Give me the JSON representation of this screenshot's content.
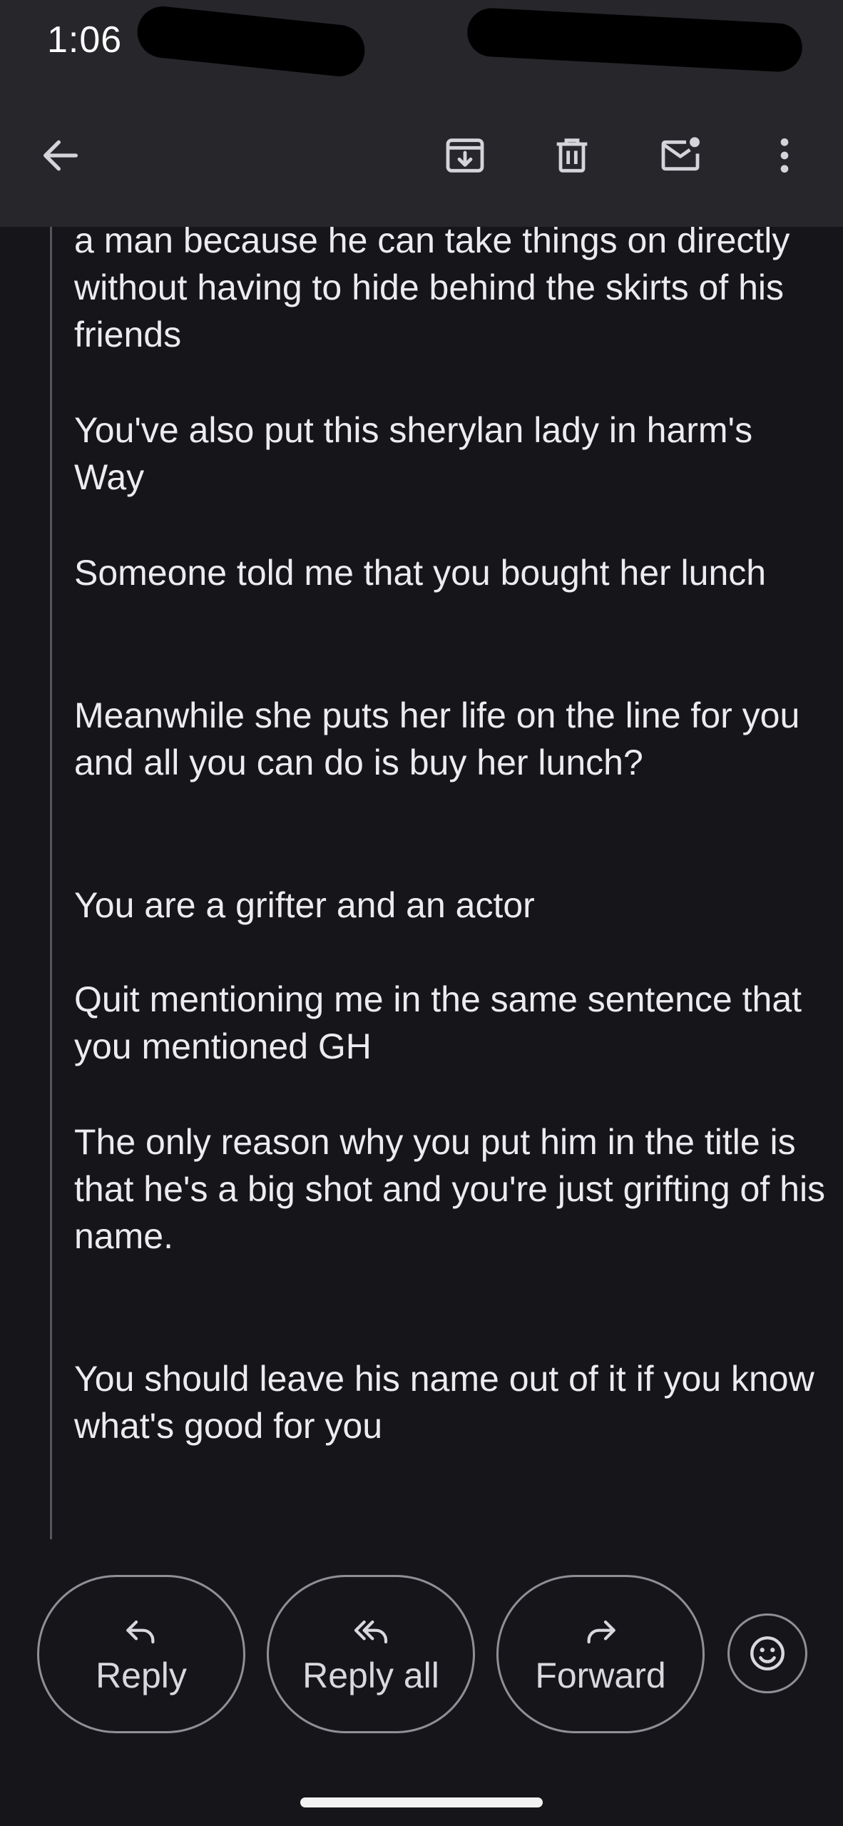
{
  "status_bar": {
    "time": "1:06"
  },
  "toolbar": {
    "back_icon": "arrow-left-icon",
    "archive_icon": "archive-icon",
    "delete_icon": "trash-icon",
    "mark_unread_icon": "mail-unread-icon",
    "more_icon": "more-vert-icon"
  },
  "message": {
    "paragraphs": [
      "a man because he can take things on directly without having to hide behind the skirts of his friends",
      "You've also put this sherylan lady in harm's Way",
      "Someone told me that you bought her lunch",
      "Meanwhile she puts her life on the line for you and all you can do is buy her lunch?",
      "You are a grifter and an actor",
      "Quit mentioning me in the same sentence that you mentioned GH",
      "The only reason why you put him in the title is that he's a big shot and you're just grifting of his name.",
      "You should leave his name out of it if you know what's good for you"
    ]
  },
  "actions": {
    "reply_label": "Reply",
    "reply_all_label": "Reply all",
    "forward_label": "Forward",
    "emoji_icon": "emoji-icon"
  },
  "colors": {
    "background": "#16161a",
    "toolbar": "#26262b",
    "text": "#ececf0",
    "pill_border": "#8f8f96"
  }
}
